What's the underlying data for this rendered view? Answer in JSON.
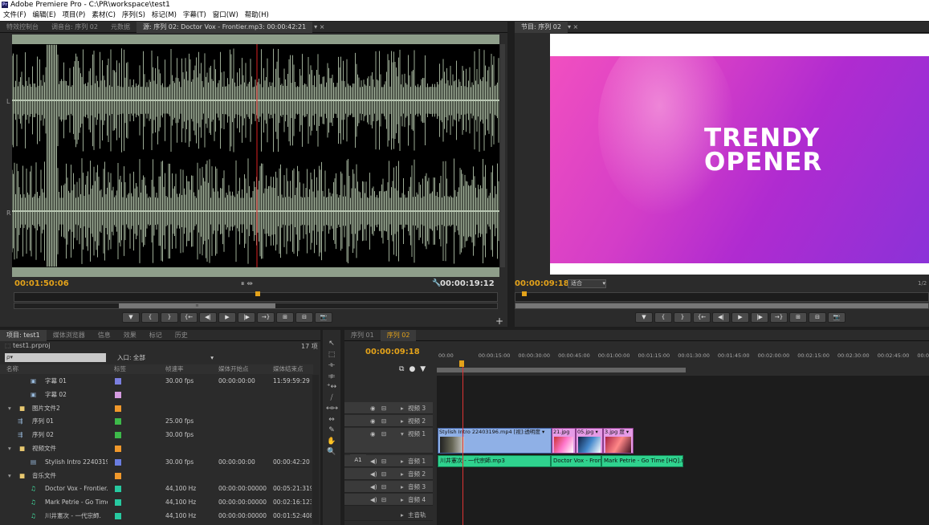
{
  "app": {
    "title": "Adobe Premiere Pro - C:\\PR\\workspace\\test1",
    "icon": "Pr"
  },
  "menu": [
    "文件(F)",
    "编辑(E)",
    "项目(P)",
    "素材(C)",
    "序列(S)",
    "标记(M)",
    "字幕(T)",
    "窗口(W)",
    "帮助(H)"
  ],
  "source_panel": {
    "tabs": [
      "特效控制台",
      "调音台: 序列 02",
      "元数据",
      "源: 序列 02: Doctor Vox - Frontier.mp3: 00:00:42:21"
    ],
    "channel_left": "L",
    "channel_right": "R",
    "timecode_current": "00:01:50:06",
    "timecode_duration": "00:00:19:12",
    "mid_icons": "⏸ ⇹",
    "ruler_center": "≡"
  },
  "program_panel": {
    "tab": "节目: 序列 02",
    "timecode": "00:00:09:18",
    "fit": "适合",
    "scale": "1/2",
    "video_title_line1": "TRENDY",
    "video_title_line2": "OPENER"
  },
  "project_panel": {
    "tabs": [
      "项目: test1",
      "媒体浏览器",
      "信息",
      "效果",
      "标记",
      "历史"
    ],
    "project_file": "test1.prproj",
    "item_count": "17 项",
    "search_placeholder": "ρ▾",
    "entry_label": "入口: 全部",
    "columns": [
      "名称",
      "标签",
      "帧速率",
      "媒体开始点",
      "媒体结束点"
    ],
    "rows": [
      {
        "name": "字幕 01",
        "color": "#7b7fe0",
        "fps": "30.00 fps",
        "start": "00:00:00:00",
        "end": "11:59:59:29",
        "indent": 2,
        "icon": "▣"
      },
      {
        "name": "字幕 02",
        "color": "#d59be0",
        "fps": "",
        "start": "",
        "end": "",
        "indent": 2,
        "icon": "▣"
      },
      {
        "name": "图片文件2",
        "color": "#f0982b",
        "fps": "",
        "start": "",
        "end": "",
        "indent": 1,
        "icon": "▶"
      },
      {
        "name": "序列 01",
        "color": "#3dba4a",
        "fps": "25.00 fps",
        "start": "",
        "end": "",
        "indent": 1,
        "icon": "⇶"
      },
      {
        "name": "序列 02",
        "color": "#3dba4a",
        "fps": "30.00 fps",
        "start": "",
        "end": "",
        "indent": 1,
        "icon": "⇶"
      },
      {
        "name": "视频文件",
        "color": "#f0982b",
        "fps": "",
        "start": "",
        "end": "",
        "indent": 1,
        "icon": "▶"
      },
      {
        "name": "Stylish Intro 22403196.",
        "color": "#6a7de0",
        "fps": "30.00 fps",
        "start": "00:00:00:00",
        "end": "00:00:42:20",
        "indent": 2,
        "icon": "▤"
      },
      {
        "name": "音乐文件",
        "color": "#f0982b",
        "fps": "",
        "start": "",
        "end": "",
        "indent": 1,
        "icon": "▶"
      },
      {
        "name": "Doctor Vox - Frontier.n",
        "color": "#27c9a0",
        "fps": "44,100 Hz",
        "start": "00:00:00:00000",
        "end": "00:05:21:319",
        "indent": 2,
        "icon": "♫"
      },
      {
        "name": "Mark Petrie - Go Time [",
        "color": "#27c9a0",
        "fps": "44,100 Hz",
        "start": "00:00:00:00000",
        "end": "00:02:16:123",
        "indent": 2,
        "icon": "♫"
      },
      {
        "name": "川井憲次 - 一代宗師.",
        "color": "#27c9a0",
        "fps": "44,100 Hz",
        "start": "00:00:00:00000",
        "end": "00:01:52:408",
        "indent": 2,
        "icon": "♫"
      }
    ]
  },
  "tools": [
    "↖",
    "⬚",
    "⟛",
    "⟚",
    "⁺↔",
    "⧸",
    "↤↦",
    "⇔",
    "✎",
    "✋",
    "🔍"
  ],
  "timeline": {
    "tabs": [
      "序列 01",
      "序列 02"
    ],
    "timecode": "00:00:09:18",
    "ruler": [
      "00:00",
      "00:00:15:00",
      "00:00:30:00",
      "00:00:45:00",
      "00:01:00:00",
      "00:01:15:00",
      "00:01:30:00",
      "00:01:45:00",
      "00:02:00:00",
      "00:02:15:00",
      "00:02:30:00",
      "00:02:45:00",
      "00:03:00:0"
    ],
    "tracks": [
      "视频 3",
      "视频 2",
      "视频 1",
      "音频 1",
      "音频 2",
      "音频 3",
      "音频 4",
      "主音轨"
    ],
    "a1_label": "A1",
    "clips": {
      "v1_a": "Stylish Intro 22403196.mp4 [视]:透明度 ▾",
      "v1_b": "21.jpg",
      "v1_c": "05.jpg ▾",
      "v1_d": "3.jpg 度 ▾",
      "a1_a": "川井憲次 - 一代宗師.mp3",
      "a1_b": "Doctor Vox - Fron",
      "a1_c": "Mark Petrie - Go Time [HQ].n"
    }
  }
}
